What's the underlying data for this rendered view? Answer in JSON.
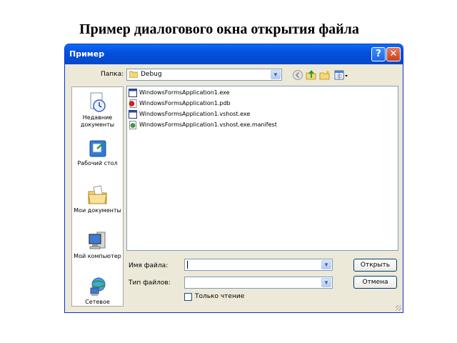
{
  "slide_title": "Пример диалогового окна открытия файла",
  "dialog": {
    "title": "Пример",
    "help_glyph": "?",
    "close_glyph": "✕",
    "folder_label": "Папка:",
    "folder_value": "Debug",
    "toolbar_icons": [
      "back-icon",
      "up-folder-icon",
      "new-folder-icon",
      "view-menu-icon"
    ]
  },
  "places": [
    {
      "label": "Недавние документы",
      "icon": "recent-documents-icon"
    },
    {
      "label": "Рабочий стол",
      "icon": "desktop-icon"
    },
    {
      "label": "Мои документы",
      "icon": "my-documents-icon"
    },
    {
      "label": "Мой компьютер",
      "icon": "my-computer-icon"
    },
    {
      "label": "Сетевое",
      "icon": "network-icon"
    }
  ],
  "files": [
    {
      "name": "WindowsFormsApplication1.exe",
      "icon": "exe-icon"
    },
    {
      "name": "WindowsFormsApplication1.pdb",
      "icon": "pdb-icon"
    },
    {
      "name": "WindowsFormsApplication1.vshost.exe",
      "icon": "exe-icon"
    },
    {
      "name": "WindowsFormsApplication1.vshost.exe.manifest",
      "icon": "manifest-icon"
    }
  ],
  "filename_label": "Имя файла:",
  "filename_value": "",
  "filetype_label": "Тип файлов:",
  "filetype_value": "",
  "open_button": "Открыть",
  "cancel_button": "Отмена",
  "readonly_label": "Только чтение",
  "colors": {
    "titlebar": "#0550de",
    "dialog_bg": "#ece9d8",
    "border": "#7f9db9"
  }
}
